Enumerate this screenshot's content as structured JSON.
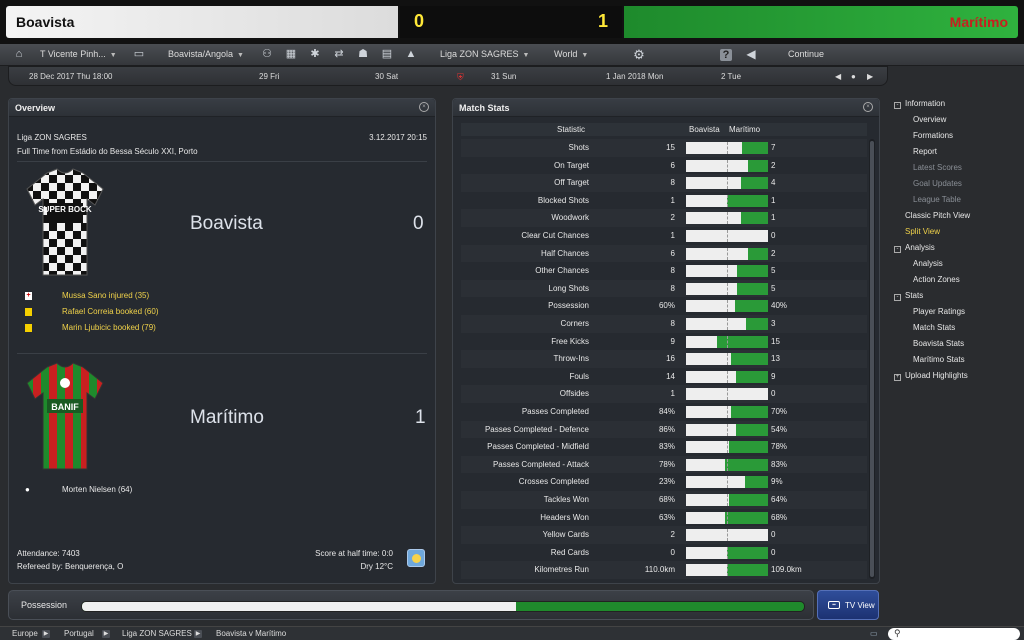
{
  "scoreboard": {
    "home_team": "Boavista",
    "home_score": "0",
    "away_score": "1",
    "away_team": "Marítimo",
    "home_color": "#f0f0f0",
    "away_color": "#2a9a38"
  },
  "toolbar": {
    "manager": "T Vicente Pinh...",
    "club": "Boavista/Angola",
    "competition": "Liga ZON SAGRES",
    "world": "World",
    "continue": "Continue"
  },
  "calendar": {
    "current_date": "28 Dec 2017",
    "current_day": "Thu",
    "current_time": "18:00",
    "days": [
      {
        "date": "29",
        "day": "Fri"
      },
      {
        "date": "30",
        "day": "Sat"
      },
      {
        "date": "31",
        "day": "Sun"
      },
      {
        "date": "1 Jan 2018",
        "day": "Mon"
      },
      {
        "date": "2",
        "day": "Tue"
      }
    ]
  },
  "overview": {
    "title": "Overview",
    "competition": "Liga ZON SAGRES",
    "datetime": "3.12.2017 20:15",
    "venue": "Full Time from Estádio do Bessa Século XXI, Porto",
    "home": {
      "name": "Boavista",
      "score": "0",
      "shirt_text": "SUPER BOCK",
      "events": [
        {
          "text": "Mussa Sano injured (35)",
          "icon": "injury-icon"
        },
        {
          "text": "Rafael Correia booked (60)",
          "icon": "yellow-card-icon"
        },
        {
          "text": "Marin Ljubicic booked (79)",
          "icon": "yellow-card-icon"
        }
      ]
    },
    "away": {
      "name": "Marítimo",
      "score": "1",
      "shirt_text": "BANIF",
      "events": [
        {
          "text": "Morten Nielsen (64)",
          "icon": "goal-ball-icon"
        }
      ]
    },
    "attendance": "Attendance: 7403",
    "referee": "Refereed by: Benquerença, O",
    "half_time": "Score at half time: 0:0",
    "weather": "Dry 12°C"
  },
  "match_stats": {
    "title": "Match Stats",
    "col_statistic": "Statistic",
    "col_home": "Boavista",
    "col_away": "Marítimo",
    "rows": [
      {
        "label": "Shots",
        "home": "15",
        "away": "7",
        "home_share": 0.68
      },
      {
        "label": "On Target",
        "home": "6",
        "away": "2",
        "home_share": 0.75
      },
      {
        "label": "Off Target",
        "home": "8",
        "away": "4",
        "home_share": 0.67
      },
      {
        "label": "Blocked Shots",
        "home": "1",
        "away": "1",
        "home_share": 0.5
      },
      {
        "label": "Woodwork",
        "home": "2",
        "away": "1",
        "home_share": 0.67
      },
      {
        "label": "Clear Cut Chances",
        "home": "1",
        "away": "0",
        "home_share": 1.0
      },
      {
        "label": "Half Chances",
        "home": "6",
        "away": "2",
        "home_share": 0.75
      },
      {
        "label": "Other Chances",
        "home": "8",
        "away": "5",
        "home_share": 0.62
      },
      {
        "label": "Long Shots",
        "home": "8",
        "away": "5",
        "home_share": 0.62
      },
      {
        "label": "Possession",
        "home": "60%",
        "away": "40%",
        "home_share": 0.6
      },
      {
        "label": "Corners",
        "home": "8",
        "away": "3",
        "home_share": 0.73
      },
      {
        "label": "Free Kicks",
        "home": "9",
        "away": "15",
        "home_share": 0.38
      },
      {
        "label": "Throw-Ins",
        "home": "16",
        "away": "13",
        "home_share": 0.55
      },
      {
        "label": "Fouls",
        "home": "14",
        "away": "9",
        "home_share": 0.61
      },
      {
        "label": "Offsides",
        "home": "1",
        "away": "0",
        "home_share": 1.0
      },
      {
        "label": "Passes Completed",
        "home": "84%",
        "away": "70%",
        "home_share": 0.55
      },
      {
        "label": "Passes Completed - Defence",
        "home": "86%",
        "away": "54%",
        "home_share": 0.61
      },
      {
        "label": "Passes Completed - Midfield",
        "home": "83%",
        "away": "78%",
        "home_share": 0.52
      },
      {
        "label": "Passes Completed - Attack",
        "home": "78%",
        "away": "83%",
        "home_share": 0.48
      },
      {
        "label": "Crosses Completed",
        "home": "23%",
        "away": "9%",
        "home_share": 0.72
      },
      {
        "label": "Tackles Won",
        "home": "68%",
        "away": "64%",
        "home_share": 0.52
      },
      {
        "label": "Headers Won",
        "home": "63%",
        "away": "68%",
        "home_share": 0.48
      },
      {
        "label": "Yellow Cards",
        "home": "2",
        "away": "0",
        "home_share": 1.0
      },
      {
        "label": "Red Cards",
        "home": "0",
        "away": "0",
        "home_share": 0.5
      },
      {
        "label": "Kilometres Run",
        "home": "110.0km",
        "away": "109.0km",
        "home_share": 0.5
      }
    ]
  },
  "side_menu": [
    {
      "label": "Information",
      "level": 0,
      "expander": "-"
    },
    {
      "label": "Overview",
      "level": 1
    },
    {
      "label": "Formations",
      "level": 1
    },
    {
      "label": "Report",
      "level": 1
    },
    {
      "label": "Latest Scores",
      "level": 1,
      "dim": true
    },
    {
      "label": "Goal Updates",
      "level": 1,
      "dim": true
    },
    {
      "label": "League Table",
      "level": 1,
      "dim": true
    },
    {
      "label": "Classic Pitch View",
      "level": 0
    },
    {
      "label": "Split View",
      "level": 0,
      "active": true
    },
    {
      "label": "Analysis",
      "level": 0,
      "expander": "-"
    },
    {
      "label": "Analysis",
      "level": 1
    },
    {
      "label": "Action Zones",
      "level": 1
    },
    {
      "label": "Stats",
      "level": 0,
      "expander": "-"
    },
    {
      "label": "Player Ratings",
      "level": 1
    },
    {
      "label": "Match Stats",
      "level": 1
    },
    {
      "label": "Boavista Stats",
      "level": 1
    },
    {
      "label": "Marítimo Stats",
      "level": 1
    },
    {
      "label": "Upload Highlights",
      "level": 0,
      "expander": "+"
    }
  ],
  "possession_bar": {
    "label": "Possession",
    "home_share": 0.6
  },
  "tv_view": {
    "label": "TV View"
  },
  "breadcrumb": [
    "Europe",
    "Portugal",
    "Liga ZON SAGRES",
    "Boavista v Marítimo"
  ]
}
